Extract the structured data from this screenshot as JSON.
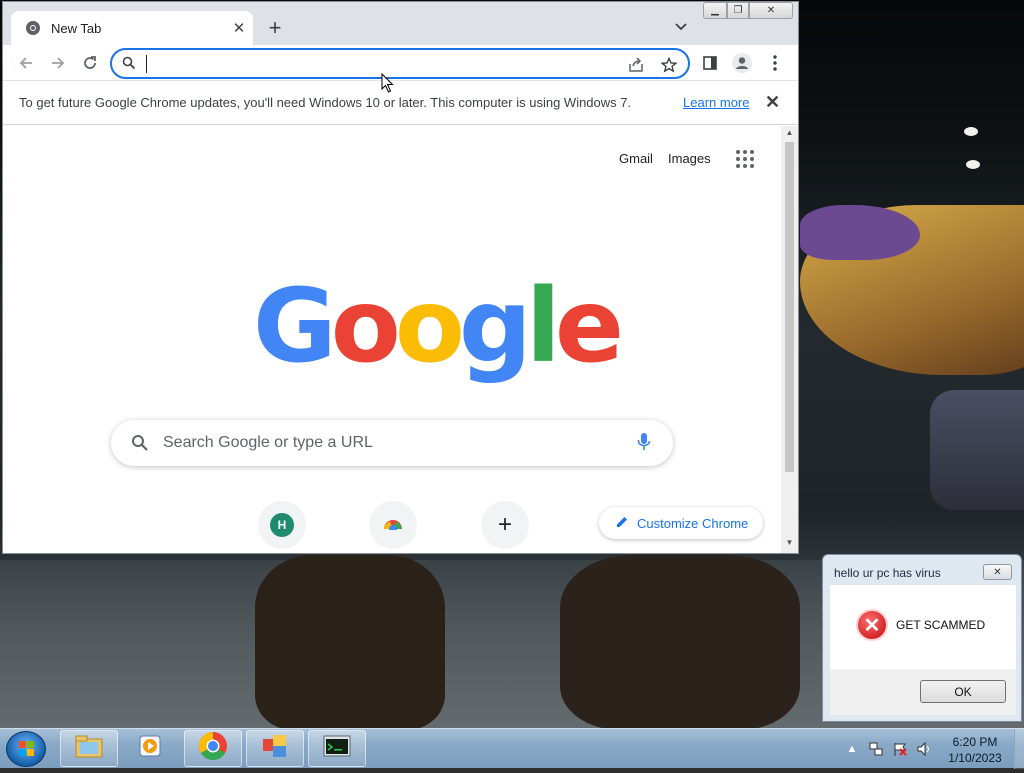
{
  "browser": {
    "tab": {
      "title": "New Tab"
    },
    "omnibox": {
      "value": "",
      "placeholder": ""
    },
    "infobar": {
      "message": "To get future Google Chrome updates, you'll need Windows 10 or later. This computer is using Windows 7.",
      "link": "Learn more"
    },
    "ntp": {
      "top_links": [
        "Gmail",
        "Images"
      ],
      "logo_letters": [
        {
          "char": "G",
          "color": "#4285f4"
        },
        {
          "char": "o",
          "color": "#ea4335"
        },
        {
          "char": "o",
          "color": "#fbbc05"
        },
        {
          "char": "g",
          "color": "#4285f4"
        },
        {
          "char": "l",
          "color": "#34a853"
        },
        {
          "char": "e",
          "color": "#ea4335"
        }
      ],
      "search_placeholder": "Search Google or type a URL",
      "shortcuts": [
        {
          "initial": "H",
          "color": "#1e8a6e"
        },
        {
          "initial": "",
          "icon": "chrome-web-store-icon"
        },
        {
          "initial": "+",
          "icon": "add-shortcut-icon"
        }
      ],
      "customize_label": "Customize Chrome"
    }
  },
  "dialog": {
    "title": "hello ur pc has virus",
    "message": "GET SCAMMED",
    "ok_label": "OK",
    "icon": "error-icon"
  },
  "taskbar": {
    "items": [
      "windows-explorer-icon",
      "media-player-icon",
      "chrome-icon",
      "app-icon",
      "terminal-icon"
    ],
    "clock": {
      "time": "6:20 PM",
      "date": "1/10/2023"
    }
  }
}
